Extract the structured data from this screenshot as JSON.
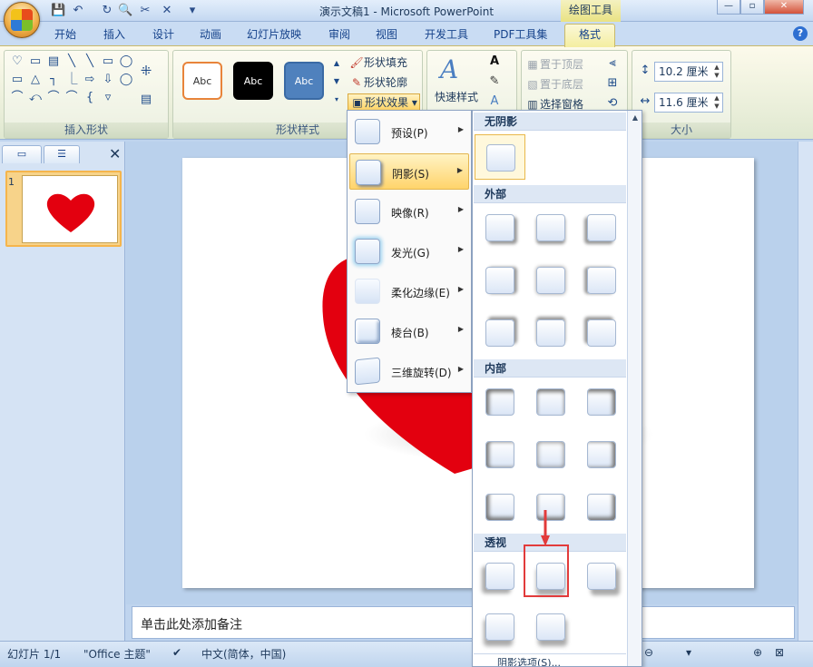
{
  "window": {
    "title": "演示文稿1 - Microsoft PowerPoint",
    "context_tab": "绘图工具",
    "controls": {
      "minimize": "—",
      "restore": "▫",
      "close": "✕"
    }
  },
  "tabs": [
    "开始",
    "插入",
    "设计",
    "动画",
    "幻灯片放映",
    "审阅",
    "视图",
    "开发工具",
    "PDF工具集",
    "格式"
  ],
  "ribbon": {
    "insert_shapes": {
      "label": "插入形状",
      "shapes": [
        "♡",
        "▭",
        "▤",
        "╲",
        "╲",
        "▭",
        "◯",
        "▭",
        "△",
        "┐",
        "⎿",
        "⇨",
        "⇩",
        "◯",
        "⌒",
        "⤺",
        "⌒",
        "⌒",
        "{",
        "▿"
      ]
    },
    "shape_styles": {
      "label": "形状样式",
      "samples": [
        {
          "text": "Abc",
          "bg": "#ffffff",
          "fg": "#333333",
          "border": "#e8843a"
        },
        {
          "text": "Abc",
          "bg": "#000000",
          "fg": "#ffffff",
          "border": "#000000"
        },
        {
          "text": "Abc",
          "bg": "#4f81bd",
          "fg": "#ffffff",
          "border": "#3a6aa4"
        }
      ],
      "fill": "形状填充",
      "outline": "形状轮廓",
      "effects": "形状效果"
    },
    "art": {
      "quick_styles": "快速样式"
    },
    "arrange": {
      "bring_front": "置于顶层",
      "send_back": "置于底层",
      "selection_pane": "选择窗格"
    },
    "size": {
      "label": "大小",
      "height": "10.2 厘米",
      "width": "11.6 厘米"
    }
  },
  "effects_menu": {
    "items": [
      {
        "label": "预设(P)",
        "active": false
      },
      {
        "label": "阴影(S)",
        "active": true
      },
      {
        "label": "映像(R)",
        "active": false
      },
      {
        "label": "发光(G)",
        "active": false
      },
      {
        "label": "柔化边缘(E)",
        "active": false
      },
      {
        "label": "棱台(B)",
        "active": false
      },
      {
        "label": "三维旋转(D)",
        "active": false
      }
    ]
  },
  "shadow_gallery": {
    "sections": {
      "none": "无阴影",
      "outer": "外部",
      "inner": "内部",
      "perspective": "透视"
    },
    "options": "阴影选项(S)..."
  },
  "left_panel": {
    "slide_number": "1"
  },
  "notes": {
    "placeholder": "单击此处添加备注"
  },
  "status": {
    "slide": "幻灯片 1/1",
    "theme": "\"Office 主题\"",
    "language": "中文(简体，中国)"
  },
  "colors": {
    "heart": "#e3000f",
    "accent": "#e23b3b"
  }
}
